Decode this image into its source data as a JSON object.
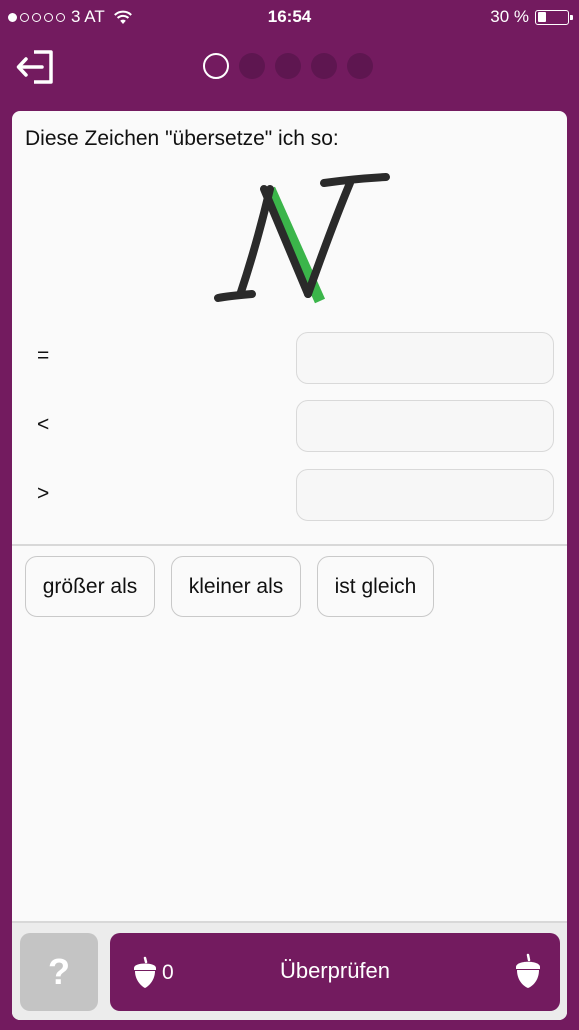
{
  "status_bar": {
    "carrier": "3 AT",
    "time": "16:54",
    "battery": "30 %",
    "battery_level": 0.3,
    "signal_bars_filled": 1,
    "signal_bars_total": 5
  },
  "nav": {
    "exit_icon": "exit-icon",
    "progress_total": 5,
    "progress_current": 1
  },
  "task": {
    "prompt": "Diese Zeichen \"übersetze\" ich so:",
    "rows": [
      {
        "symbol": "=",
        "answer": ""
      },
      {
        "symbol": "<",
        "answer": ""
      },
      {
        "symbol": ">",
        "answer": ""
      }
    ]
  },
  "choices": [
    "größer als",
    "kleiner als",
    "ist gleich"
  ],
  "footer": {
    "hint_label": "?",
    "check_label": "Überprüfen",
    "acorn_count": "0"
  },
  "colors": {
    "brand": "#731b5f",
    "glyph_accent": "#3bb54a",
    "glyph_stroke": "#2a2a2a"
  }
}
